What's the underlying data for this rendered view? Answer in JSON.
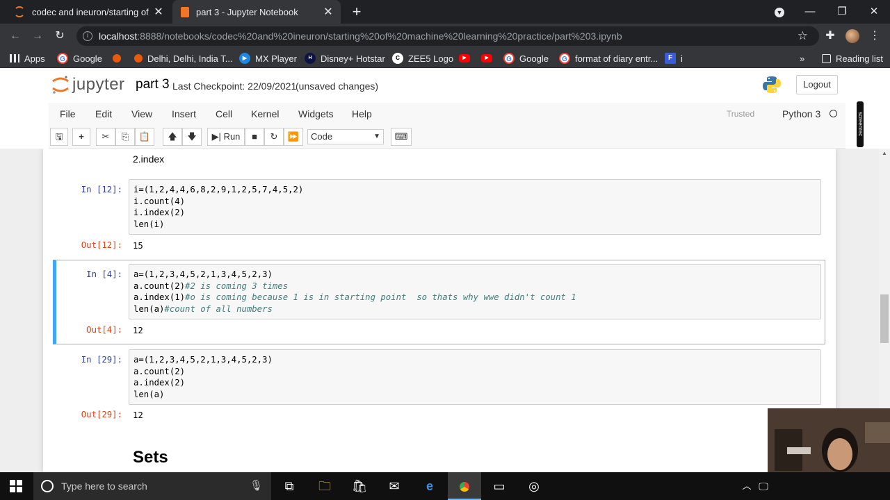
{
  "browser": {
    "tabs": [
      {
        "title": "codec and ineuron/starting of m",
        "active": false
      },
      {
        "title": "part 3 - Jupyter Notebook",
        "active": true
      }
    ],
    "url": {
      "host": "localhost",
      "rest": ":8888/notebooks/codec%20and%20ineuron/starting%20of%20machine%20learning%20practice/part%203.ipynb"
    },
    "bookmarks": [
      "Apps",
      "Google",
      "Delhi, Delhi, India T...",
      "MX Player",
      "Disney+ Hotstar",
      "ZEE5 Logo",
      "Google",
      "format of diary entr...",
      "i"
    ],
    "reading_list": "Reading list",
    "more_bookmarks": "»"
  },
  "jupyter": {
    "logo_text": "jupyter",
    "notebook_name": "part 3",
    "checkpoint": "Last Checkpoint: 22/09/2021",
    "status": "(unsaved changes)",
    "logout": "Logout",
    "menus": [
      "File",
      "Edit",
      "View",
      "Insert",
      "Cell",
      "Kernel",
      "Widgets",
      "Help"
    ],
    "trusted": "Trusted",
    "kernel": "Python 3",
    "run_label": "Run",
    "cell_type": "Code"
  },
  "notebook": {
    "markdown_top": "2.index",
    "cells": [
      {
        "in_prompt": "In [12]:",
        "lines": [
          "i=(1,2,4,4,6,8,2,9,1,2,5,7,4,5,2)",
          "i.count(4)",
          "i.index(2)",
          "len(i)"
        ],
        "out_prompt": "Out[12]:",
        "output": "15"
      },
      {
        "in_prompt": "In [4]:",
        "lines": [
          "a=(1,2,3,4,5,2,1,3,4,5,2,3)",
          "a.count(2)",
          "a.index(1)",
          "len(a)"
        ],
        "comments": [
          "",
          "#2 is coming 3 times",
          "#o is coming because 1 is in starting point  so thats why wwe didn't count 1",
          "#count of all numbers"
        ],
        "out_prompt": "Out[4]:",
        "output": "12"
      },
      {
        "in_prompt": "In [29]:",
        "lines": [
          "a=(1,2,3,4,5,2,1,3,4,5,2,3)",
          "a.count(2)",
          "a.index(2)",
          "len(a)"
        ],
        "out_prompt": "Out[29]:",
        "output": "12"
      }
    ],
    "heading": "Sets"
  },
  "taskbar": {
    "search_placeholder": "Type here to search"
  },
  "overlay": {
    "screenrec": "screenrec"
  },
  "colors": {
    "accent_selected": "#42a5f5",
    "in_prompt": "#303f9f",
    "out_prompt": "#d84315",
    "comment": "#408080"
  }
}
